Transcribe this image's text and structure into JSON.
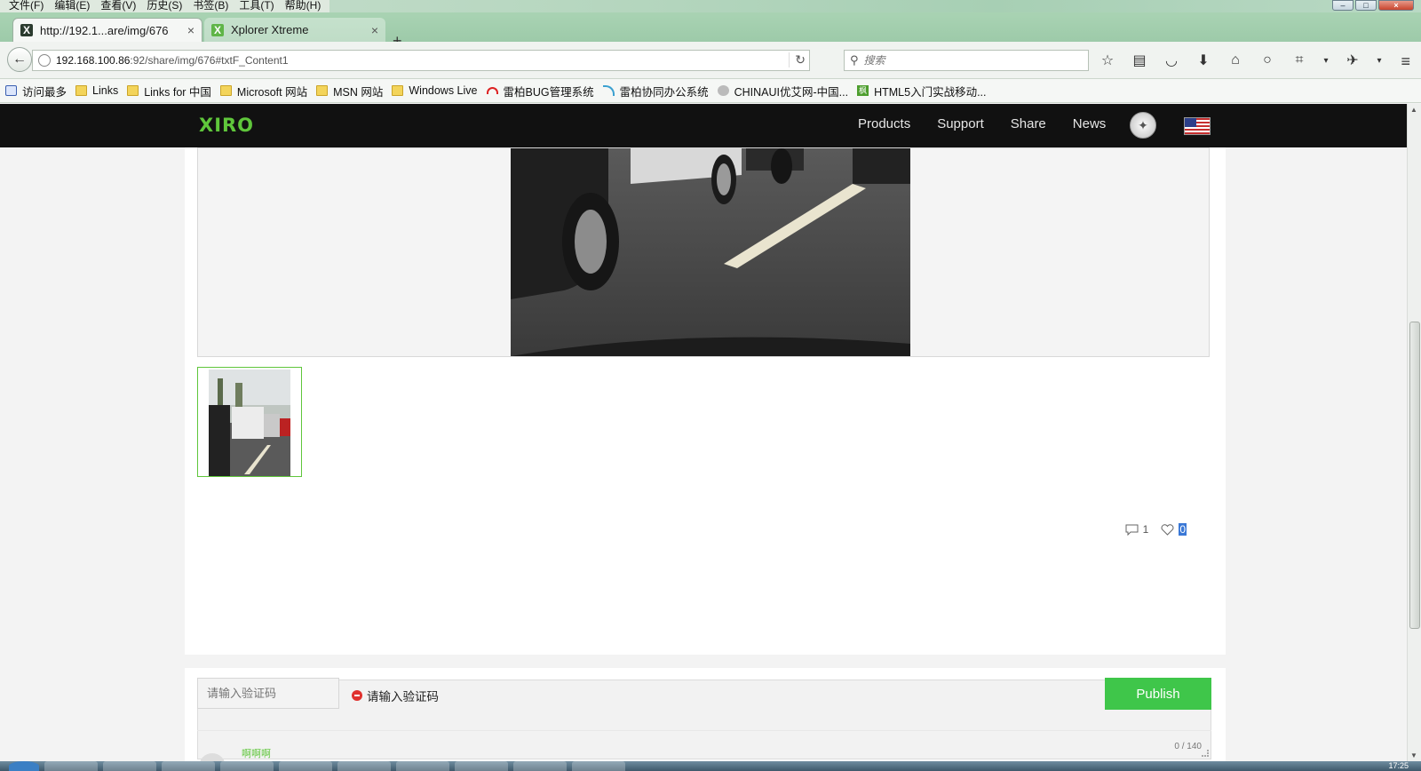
{
  "browser": {
    "menu": [
      "文件(F)",
      "编辑(E)",
      "查看(V)",
      "历史(S)",
      "书签(B)",
      "工具(T)",
      "帮助(H)"
    ],
    "tabs": [
      {
        "title": "http://192.1...are/img/676",
        "active": true
      },
      {
        "title": "Xplorer Xtreme",
        "active": false
      }
    ],
    "new_tab": "+",
    "url_host": "192.168.100.86",
    "url_rest": ":92/share/img/676#txtF_Content1",
    "search_placeholder": "搜索",
    "bookmarks": [
      {
        "label": "访问最多",
        "icon": "search-folder-icon"
      },
      {
        "label": "Links",
        "icon": "folder-icon"
      },
      {
        "label": "Links for 中国",
        "icon": "folder-icon"
      },
      {
        "label": "Microsoft 网站",
        "icon": "folder-icon"
      },
      {
        "label": "MSN 网站",
        "icon": "folder-icon"
      },
      {
        "label": "Windows Live",
        "icon": "folder-icon"
      },
      {
        "label": "雷柏BUG管理系统",
        "icon": "rapoo-icon"
      },
      {
        "label": "雷柏协同办公系统",
        "icon": "signal-icon"
      },
      {
        "label": "CHINAUI优艾网-中国...",
        "icon": "site-icon"
      },
      {
        "label": "HTML5入门实战移动...",
        "icon": "green-site-icon"
      }
    ]
  },
  "site": {
    "logo": "XIRO",
    "nav": [
      "Products",
      "Support",
      "Share",
      "News"
    ],
    "brand_color": "#5fc63b"
  },
  "post": {
    "comment_count": "1",
    "like_count": "0"
  },
  "comment_form": {
    "counter": "0 / 140",
    "captcha_placeholder": "请输入验证码",
    "captcha_error": "请输入验证码",
    "publish_label": "Publish",
    "publish_color": "#3fc64a"
  },
  "reply": {
    "username": "啊啊啊"
  },
  "taskbar": {
    "clock": "17:25"
  }
}
